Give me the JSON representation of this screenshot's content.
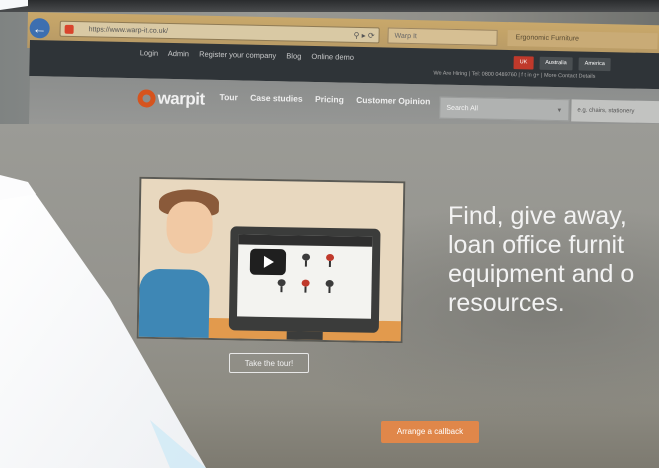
{
  "browser": {
    "url": "https://www.warp-it.co.uk/",
    "tab_active": "Warp It",
    "tab_other": "Ergonomic Furniture"
  },
  "topnav": {
    "links": [
      "Login",
      "Admin",
      "Register your company",
      "Blog",
      "Online demo"
    ],
    "hiring": "We Are Hiring | Tel: 0800 0489760 | f  t  in  g+  |  More Contact Details",
    "right_buttons": [
      "UK",
      "Australia",
      "America"
    ]
  },
  "header": {
    "logo": "warpit",
    "nav": [
      "Tour",
      "Case studies",
      "Pricing",
      "Customer Opinion"
    ],
    "search_select": "Search All",
    "search_placeholder": "e.g. chairs, stationery"
  },
  "hero": {
    "headline": [
      "Find, give away,",
      "loan office furnit",
      "equipment and o",
      "resources."
    ],
    "tour_button": "Take the tour!",
    "callback_button": "Arrange a callback"
  },
  "colors": {
    "brand_orange": "#e0874a",
    "nav_dark": "#2f3438",
    "accent_red": "#c0392b"
  }
}
